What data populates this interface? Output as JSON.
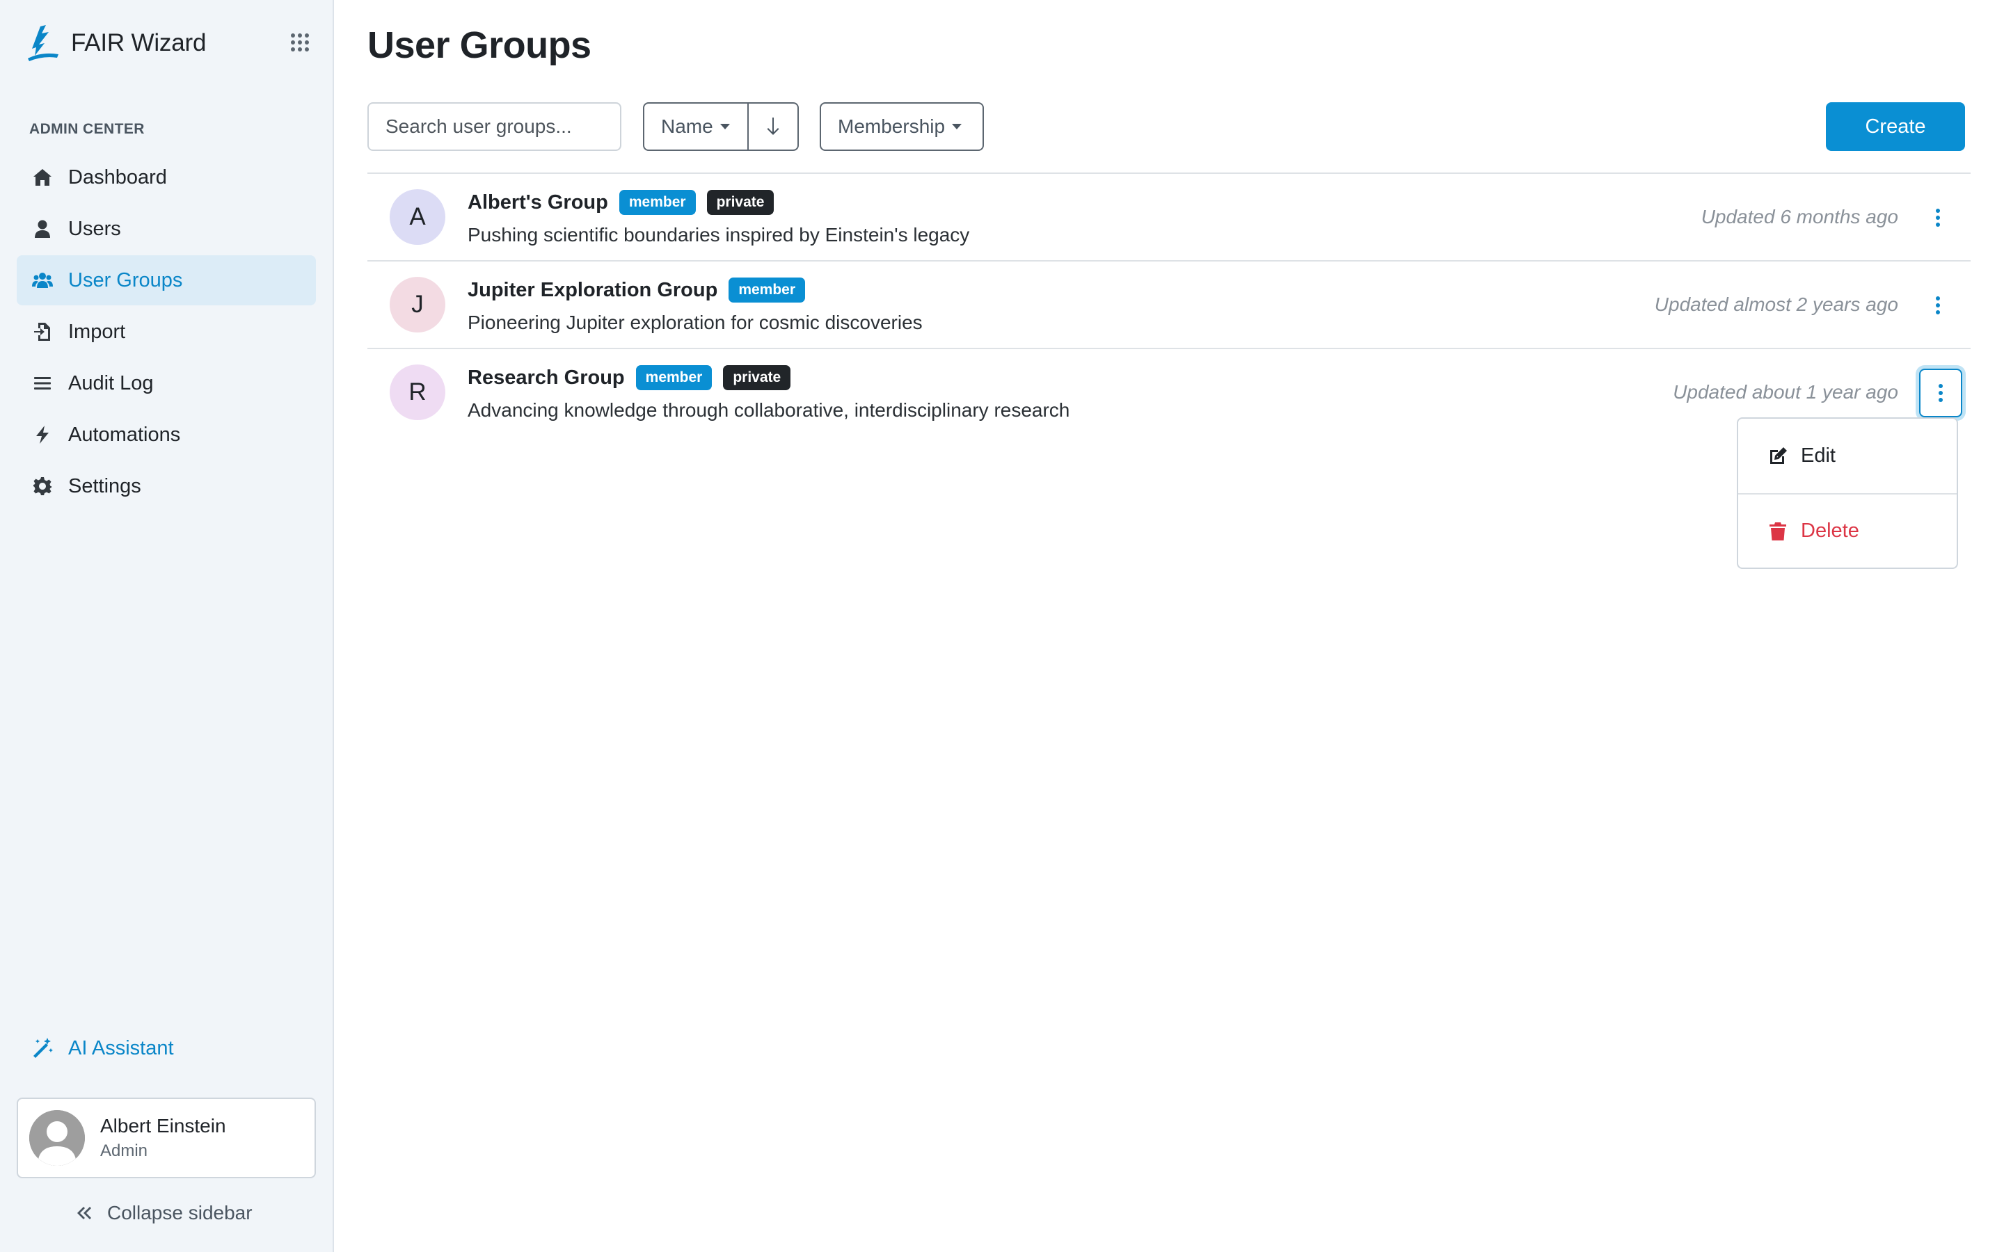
{
  "app": {
    "name": "FAIR Wizard",
    "brand_color": "#0a86c8"
  },
  "sidebar": {
    "section_title": "ADMIN CENTER",
    "items": [
      {
        "label": "Dashboard",
        "icon": "home-icon"
      },
      {
        "label": "Users",
        "icon": "user-icon"
      },
      {
        "label": "User Groups",
        "icon": "users-icon",
        "active": true
      },
      {
        "label": "Import",
        "icon": "import-icon"
      },
      {
        "label": "Audit Log",
        "icon": "list-icon"
      },
      {
        "label": "Automations",
        "icon": "bolt-icon"
      },
      {
        "label": "Settings",
        "icon": "gear-icon"
      }
    ],
    "ai_assistant": "AI Assistant",
    "user": {
      "name": "Albert Einstein",
      "role": "Admin"
    },
    "collapse": "Collapse sidebar"
  },
  "main": {
    "title": "User Groups",
    "search_placeholder": "Search user groups...",
    "sort_label": "Name",
    "sort_direction": "descending",
    "filter_label": "Membership",
    "create_label": "Create"
  },
  "groups": [
    {
      "initial": "A",
      "name": "Albert's Group",
      "badges": [
        "member",
        "private"
      ],
      "description": "Pushing scientific boundaries inspired by Einstein's legacy",
      "updated": "Updated 6 months ago",
      "avatar_color": "#dcdcf5"
    },
    {
      "initial": "J",
      "name": "Jupiter Exploration Group",
      "badges": [
        "member"
      ],
      "description": "Pioneering Jupiter exploration for cosmic discoveries",
      "updated": "Updated almost 2 years ago",
      "avatar_color": "#f3dbe3"
    },
    {
      "initial": "R",
      "name": "Research Group",
      "badges": [
        "member",
        "private"
      ],
      "description": "Advancing knowledge through collaborative, interdisciplinary research",
      "updated": "Updated about 1 year ago",
      "avatar_color": "#efdcf3"
    }
  ],
  "dropdown": {
    "edit_label": "Edit",
    "delete_label": "Delete",
    "delete_color": "#dc3545"
  }
}
